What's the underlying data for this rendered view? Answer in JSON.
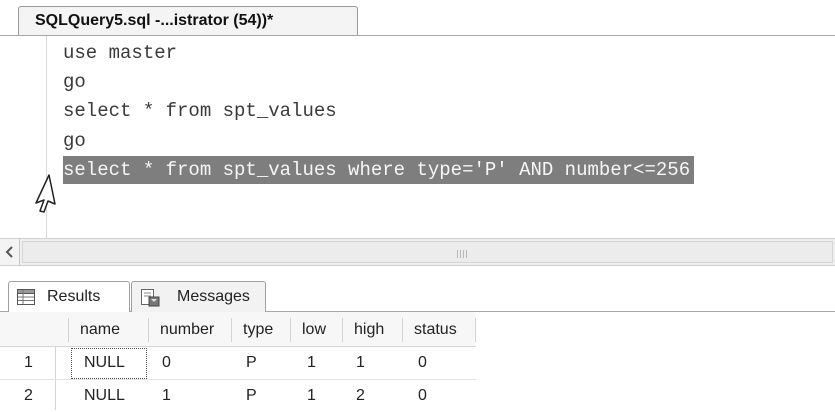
{
  "document_tab": {
    "title": "SQLQuery5.sql -...istrator (54))*"
  },
  "editor": {
    "lines": [
      "use master",
      "go",
      "select * from spt_values",
      "go",
      "select * from spt_values where type='P' AND number<=256"
    ],
    "selected_line_index": 4,
    "cursor_icon": "mouse-pointer-icon"
  },
  "results_tabs": {
    "results_label": "Results",
    "results_icon": "grid-icon",
    "messages_label": "Messages",
    "messages_icon": "messages-icon",
    "active": "Results"
  },
  "grid": {
    "columns": [
      "name",
      "number",
      "type",
      "low",
      "high",
      "status"
    ],
    "rows": [
      {
        "rownum": "1",
        "cells": [
          "NULL",
          "0",
          "P",
          "1",
          "1",
          "0"
        ]
      },
      {
        "rownum": "2",
        "cells": [
          "NULL",
          "1",
          "P",
          "1",
          "2",
          "0"
        ]
      }
    ]
  },
  "colors": {
    "selection_bg": "#7e7e7e",
    "selection_text": "#f6f6f6",
    "code_text": "#3a3a3a"
  }
}
